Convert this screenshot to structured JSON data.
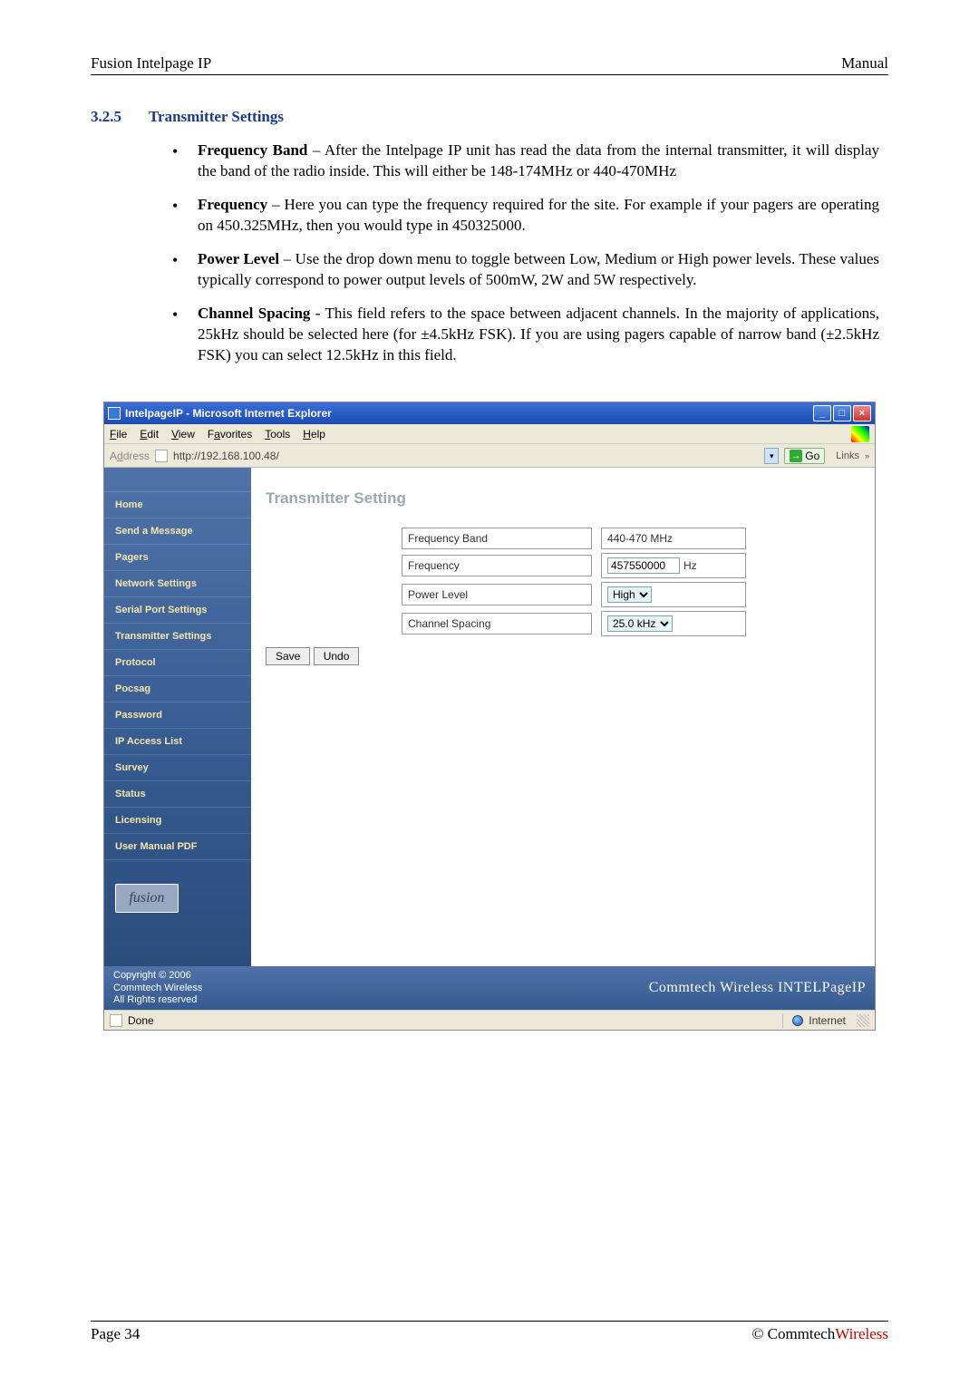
{
  "header": {
    "left": "Fusion Intelpage IP",
    "right": "Manual"
  },
  "section": {
    "number": "3.2.5",
    "title": "Transmitter Settings"
  },
  "bullets": [
    {
      "term": "Frequency Band",
      "text": " – After the Intelpage IP unit has read the data from the internal transmitter, it will display the band of the radio inside. This will either be 148-174MHz or 440-470MHz"
    },
    {
      "term": "Frequency",
      "text": " – Here you can type the frequency required for the site. For example if your pagers are operating on 450.325MHz, then you would type in 450325000."
    },
    {
      "term": "Power Level",
      "text": " – Use the drop down menu to toggle between Low, Medium or High power levels. These values typically correspond to power output levels of 500mW, 2W and 5W respectively."
    },
    {
      "term": "Channel Spacing",
      "text": " - This field refers to the space between adjacent channels. In the majority of applications, 25kHz should be selected here (for ±4.5kHz FSK). If you are using pagers capable of narrow band (±2.5kHz FSK) you can select 12.5kHz in this field."
    }
  ],
  "screenshot": {
    "title": "IntelpageIP - Microsoft Internet Explorer",
    "menus": {
      "file": "File",
      "edit": "Edit",
      "view": "View",
      "favorites": "Favorites",
      "tools": "Tools",
      "help": "Help"
    },
    "address": {
      "label": "Address",
      "url": "http://192.168.100.48/",
      "go": "Go",
      "links": "Links"
    },
    "sidebar": {
      "items": [
        "Home",
        "Send a Message",
        "Pagers",
        "Network Settings",
        "Serial Port Settings",
        "Transmitter Settings",
        "Protocol",
        "Pocsag",
        "Password",
        "IP Access List",
        "Survey",
        "Status",
        "Licensing",
        "User Manual PDF"
      ],
      "logo": "fusion"
    },
    "panel": {
      "title": "Transmitter Setting",
      "rows": {
        "freq_band": {
          "label": "Frequency Band",
          "value": "440-470 MHz"
        },
        "frequency": {
          "label": "Frequency",
          "value": "457550000",
          "unit": "Hz"
        },
        "power_level": {
          "label": "Power Level",
          "value": "High"
        },
        "channel_spacing": {
          "label": "Channel Spacing",
          "value": "25.0 kHz"
        }
      },
      "buttons": {
        "save": "Save",
        "undo": "Undo"
      }
    },
    "footer": {
      "copyright": "Copyright © 2006",
      "company": "Commtech Wireless",
      "rights": "All Rights reserved",
      "brand": "Commtech Wireless INTELPageIP"
    },
    "statusbar": {
      "done": "Done",
      "zone": "Internet"
    }
  },
  "page_footer": {
    "left": "Page 34",
    "right_pre": "© Commtech",
    "right_red": "Wireless"
  }
}
